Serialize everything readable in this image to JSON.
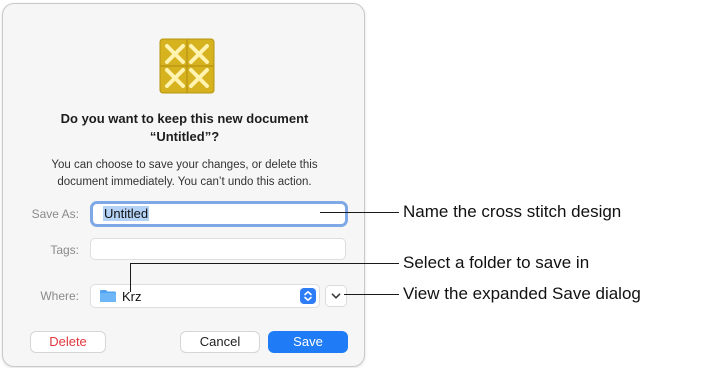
{
  "dialog": {
    "title_line1": "Do you want to keep this new document",
    "title_line2": "“Untitled”?",
    "message_line1": "You can choose to save your changes, or delete this",
    "message_line2": "document immediately. You can’t undo this action.",
    "save_as": {
      "label": "Save As:",
      "value": "Untitled"
    },
    "tags": {
      "label": "Tags:",
      "value": ""
    },
    "where": {
      "label": "Where:",
      "value": "Krz"
    },
    "buttons": {
      "delete": "Delete",
      "cancel": "Cancel",
      "save": "Save"
    }
  },
  "callouts": {
    "name": "Name the cross stitch design",
    "folder": "Select a folder to save in",
    "expand": "View the expanded Save dialog"
  },
  "colors": {
    "accent": "#1f7cf6",
    "destructive": "#e0383e",
    "icon_gold": "#d6b21f"
  },
  "icons": {
    "app": "cross-stitch-app-icon",
    "folder": "folder-icon",
    "stepper": "chevron-updown-icon",
    "expand": "chevron-down-icon"
  }
}
